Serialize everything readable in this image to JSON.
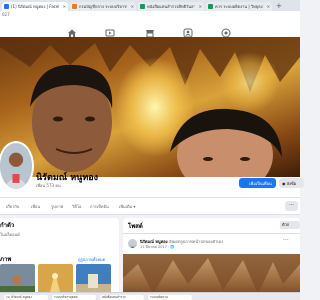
{
  "browser": {
    "tabs": [
      {
        "label": "(1) นิรัตมณ์ หนูทอง | Facebook",
        "favicon": "facebook-icon",
        "color": "#1877f2",
        "active": true
      },
      {
        "label": "กรมบัญชีกลาง ระบบบริหารบุคคล/ วิทยุลงกฎหมาย",
        "favicon": "document-icon",
        "color": "#e67c27",
        "active": false
      },
      {
        "label": "หนังสือแทนสำรวจสิทธิวันลา | โพรมนูรีร์เคล",
        "favicon": "sheet-icon",
        "color": "#0f9d58",
        "active": false
      },
      {
        "label": "ควร ระบบผลิตงาน | วิทยุลงโหมดให้ตรง",
        "favicon": "sheet-icon",
        "color": "#0f9d58",
        "active": false
      }
    ],
    "address_fragment": "027"
  },
  "nav": {
    "icons": [
      "home-icon",
      "video-icon",
      "marketplace-icon",
      "groups-icon",
      "gaming-icon"
    ]
  },
  "profile": {
    "name": "นิรัตมณ์ หนูทอง",
    "friends": "เพื่อน 573 คน",
    "add_friend_label": "เพิ่มเป็นเพื่อน",
    "message_label": "ส่งข้อ"
  },
  "profile_tabs": [
    "เกี่ยวกับ",
    "เพื่อน",
    "รูปภาพ",
    "วิดีโอ",
    "การเช็คอิน",
    "เพิ่มเติม"
  ],
  "about": {
    "title": "กำตัว",
    "text": "ในบล็ออนด์"
  },
  "photos": {
    "title": "ภาพ",
    "see_all": "ดูรูปภาพทั้งหมด"
  },
  "post": {
    "section_title": "โพสต์",
    "filter_label": "ตัวก",
    "author": "นิรัตมณ์ หนูทอง",
    "action": "อัพเดตรูปภาพหน้าปกของตัวเอง",
    "time": "11 มีนาคม 2017 · 🌐"
  },
  "taskbar": {
    "items": [
      "(1) นิรัตมณ์ หนูทอง",
      "ระบบบริหารบุคคล",
      "หนังสือแทนสำรวจ",
      "ระบบผลิตงาน"
    ]
  },
  "colors": {
    "facebook_blue": "#1877f2",
    "background": "#f0f2f5",
    "secondary_text": "#65676b"
  }
}
